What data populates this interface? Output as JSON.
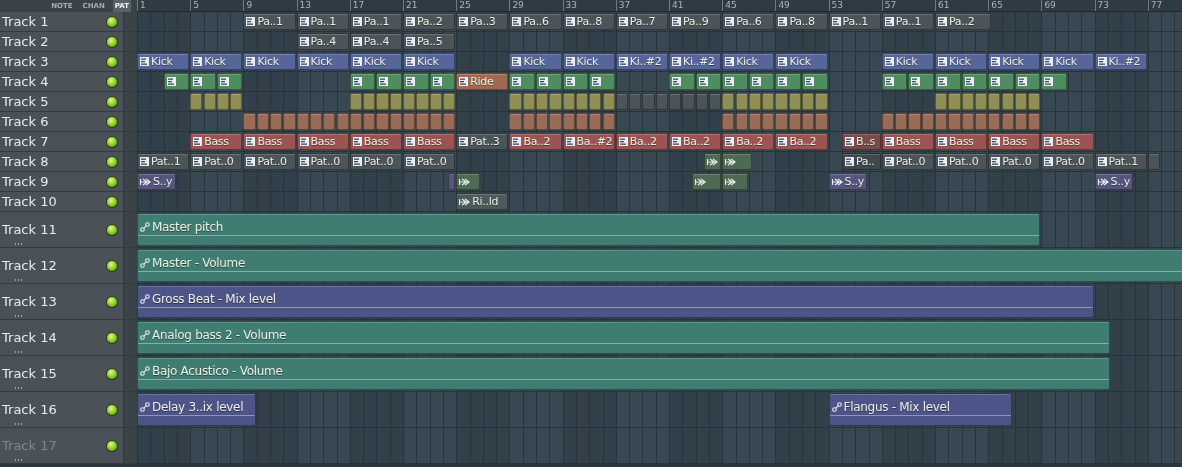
{
  "view_tabs": [
    {
      "label": "NOTE",
      "selected": false
    },
    {
      "label": "CHAN",
      "selected": false
    },
    {
      "label": "PAT",
      "selected": true
    }
  ],
  "ruler": [
    "1",
    "5",
    "9",
    "13",
    "17",
    "21",
    "25",
    "29",
    "33",
    "37",
    "41",
    "45",
    "49",
    "53",
    "57",
    "61",
    "65",
    "69",
    "73",
    "77"
  ],
  "tracks": [
    {
      "name": "Track 1",
      "tall": false,
      "disabled": false,
      "clips": [
        {
          "kind": "pattern",
          "label": "Pa..1",
          "color": "#4a5459"
        },
        {
          "kind": "pattern",
          "label": "Pa..1",
          "color": "#4a5459"
        },
        {
          "kind": "pattern",
          "label": "Pa..1",
          "color": "#4a5459"
        },
        {
          "kind": "pattern",
          "label": "Pa..2",
          "color": "#4a5459"
        },
        {
          "kind": "pattern",
          "label": "Pa..3",
          "color": "#4a5459"
        },
        {
          "kind": "pattern",
          "label": "Pa..6",
          "color": "#4a5459"
        },
        {
          "kind": "pattern",
          "label": "Pa..8",
          "color": "#4a5459"
        },
        {
          "kind": "pattern",
          "label": "Pa..7",
          "color": "#4a5459"
        },
        {
          "kind": "pattern",
          "label": "Pa..9",
          "color": "#4a5459"
        },
        {
          "kind": "pattern",
          "label": "Pa..6",
          "color": "#4a5459"
        },
        {
          "kind": "pattern",
          "label": "Pa..8",
          "color": "#4a5459"
        },
        {
          "kind": "pattern",
          "label": "Pa..1",
          "color": "#4a5459"
        },
        {
          "kind": "pattern",
          "label": "Pa..1",
          "color": "#4a5459"
        },
        {
          "kind": "pattern",
          "label": "Pa..2",
          "color": "#4a5459"
        }
      ]
    },
    {
      "name": "Track 2",
      "tall": false,
      "disabled": false,
      "clips": [
        {
          "kind": "pattern",
          "label": "Pa..4",
          "color": "#4a5459"
        },
        {
          "kind": "pattern",
          "label": "Pa..4",
          "color": "#4a5459"
        },
        {
          "kind": "pattern",
          "label": "Pa..5",
          "color": "#4a5459"
        }
      ]
    },
    {
      "name": "Track 3",
      "tall": false,
      "disabled": false,
      "clips": [
        {
          "kind": "pattern",
          "label": "Kick",
          "color": "#56669a"
        },
        {
          "kind": "pattern",
          "label": "Kick",
          "color": "#56669a"
        },
        {
          "kind": "pattern",
          "label": "Kick",
          "color": "#56669a"
        },
        {
          "kind": "pattern",
          "label": "Kick",
          "color": "#56669a"
        },
        {
          "kind": "pattern",
          "label": "Kick",
          "color": "#56669a"
        },
        {
          "kind": "pattern",
          "label": "Kick",
          "color": "#56669a"
        },
        {
          "kind": "pattern",
          "label": "Kick",
          "color": "#56669a"
        },
        {
          "kind": "pattern",
          "label": "Kick",
          "color": "#56669a"
        },
        {
          "kind": "pattern",
          "label": "Ki..#2",
          "color": "#56669a"
        },
        {
          "kind": "pattern",
          "label": "Ki..#2",
          "color": "#56669a"
        },
        {
          "kind": "pattern",
          "label": "Kick",
          "color": "#56669a"
        },
        {
          "kind": "pattern",
          "label": "Kick",
          "color": "#56669a"
        },
        {
          "kind": "pattern",
          "label": "Kick",
          "color": "#56669a"
        },
        {
          "kind": "pattern",
          "label": "Kick",
          "color": "#56669a"
        },
        {
          "kind": "pattern",
          "label": "Kick",
          "color": "#56669a"
        },
        {
          "kind": "pattern",
          "label": "Kick",
          "color": "#56669a"
        },
        {
          "kind": "pattern",
          "label": "Ki..#2",
          "color": "#56669a"
        }
      ]
    },
    {
      "name": "Track 4",
      "tall": false,
      "disabled": false,
      "clips": [
        {
          "kind": "pattern",
          "color": "#4f8d60"
        },
        {
          "kind": "pattern",
          "color": "#4f8d60"
        },
        {
          "kind": "pattern",
          "label": "Ride",
          "color": "#a06a52"
        },
        {
          "kind": "pattern",
          "color": "#4f8d60"
        },
        {
          "kind": "pattern",
          "color": "#4f8d60"
        },
        {
          "kind": "pattern",
          "color": "#4f8d60"
        }
      ]
    },
    {
      "name": "Track 5",
      "tall": false,
      "disabled": false,
      "clips": [
        {
          "kind": "pattern",
          "color": "#8e8e55"
        },
        {
          "kind": "pattern",
          "color": "#8e8e55"
        },
        {
          "kind": "pattern",
          "color": "#8e8e55"
        },
        {
          "kind": "pattern",
          "color": "#4a5459"
        },
        {
          "kind": "pattern",
          "color": "#8e8e55"
        },
        {
          "kind": "pattern",
          "color": "#8e8e55"
        }
      ]
    },
    {
      "name": "Track 6",
      "tall": false,
      "disabled": false,
      "clips": [
        {
          "kind": "pattern",
          "color": "#9a6c58"
        },
        {
          "kind": "pattern",
          "color": "#9a6c58"
        },
        {
          "kind": "pattern",
          "color": "#9a6c58"
        },
        {
          "kind": "pattern",
          "color": "#9a6c58"
        }
      ]
    },
    {
      "name": "Track 7",
      "tall": false,
      "disabled": false,
      "clips": [
        {
          "kind": "pattern",
          "label": "Bass",
          "color": "#9c5452"
        },
        {
          "kind": "pattern",
          "label": "Bass",
          "color": "#9c5452"
        },
        {
          "kind": "pattern",
          "label": "Bass",
          "color": "#9c5452"
        },
        {
          "kind": "pattern",
          "label": "Bass",
          "color": "#9c5452"
        },
        {
          "kind": "pattern",
          "label": "Bass",
          "color": "#9c5452"
        },
        {
          "kind": "pattern",
          "label": "Pat..3",
          "color": "#4a5459"
        },
        {
          "kind": "pattern",
          "label": "Ba..2",
          "color": "#9c5452"
        },
        {
          "kind": "pattern",
          "label": "Ba..#2",
          "color": "#9c5452"
        },
        {
          "kind": "pattern",
          "label": "Ba..2",
          "color": "#9c5452"
        },
        {
          "kind": "pattern",
          "label": "Ba..2",
          "color": "#9c5452"
        },
        {
          "kind": "pattern",
          "label": "Ba..2",
          "color": "#9c5452"
        },
        {
          "kind": "pattern",
          "label": "Ba..2",
          "color": "#9c5452"
        },
        {
          "kind": "pattern",
          "label": "B..s",
          "color": "#7a4a4a"
        },
        {
          "kind": "pattern",
          "label": "Bass",
          "color": "#9c5452"
        },
        {
          "kind": "pattern",
          "label": "Bass",
          "color": "#9c5452"
        },
        {
          "kind": "pattern",
          "label": "Bass",
          "color": "#9c5452"
        },
        {
          "kind": "pattern",
          "label": "Bass",
          "color": "#9c5452"
        }
      ]
    },
    {
      "name": "Track 8",
      "tall": false,
      "disabled": false,
      "clips": [
        {
          "kind": "pattern",
          "label": "Pat..1",
          "color": "#4a5459"
        },
        {
          "kind": "pattern",
          "label": "Pat..0",
          "color": "#4a5459"
        },
        {
          "kind": "pattern",
          "label": "Pat..0",
          "color": "#4a5459"
        },
        {
          "kind": "pattern",
          "label": "Pat..0",
          "color": "#4a5459"
        },
        {
          "kind": "pattern",
          "label": "Pat..0",
          "color": "#4a5459"
        },
        {
          "kind": "pattern",
          "label": "Pat..0",
          "color": "#4a5459"
        },
        {
          "kind": "audio",
          "color": "#4f6a52"
        },
        {
          "kind": "audio",
          "color": "#4f6a52"
        },
        {
          "kind": "pattern",
          "label": "Pa..",
          "color": "#3f484d"
        },
        {
          "kind": "pattern",
          "label": "Pat..0",
          "color": "#4a5459"
        },
        {
          "kind": "pattern",
          "label": "Pat..0",
          "color": "#4a5459"
        },
        {
          "kind": "pattern",
          "label": "Pat..0",
          "color": "#4a5459"
        },
        {
          "kind": "pattern",
          "label": "Pat..0",
          "color": "#4a5459"
        },
        {
          "kind": "pattern",
          "label": "Pat..1",
          "color": "#4a5459"
        },
        {
          "kind": "pattern",
          "color": "#4a5459"
        }
      ]
    },
    {
      "name": "Track 9",
      "tall": false,
      "disabled": false,
      "clips": [
        {
          "kind": "audio",
          "label": "S..y",
          "color": "#56567c"
        },
        {
          "kind": "audio",
          "color": "#56567c"
        },
        {
          "kind": "audio",
          "color": "#4f6a52"
        },
        {
          "kind": "audio",
          "color": "#4f6a52"
        },
        {
          "kind": "audio",
          "color": "#4f6a52"
        },
        {
          "kind": "audio",
          "label": "S..y",
          "color": "#56567c"
        },
        {
          "kind": "audio",
          "label": "S..y",
          "color": "#56567c"
        }
      ]
    },
    {
      "name": "Track 10",
      "tall": false,
      "disabled": false,
      "clips": [
        {
          "kind": "audio",
          "label": "Ri..ld",
          "color": "#4c5a5a"
        }
      ]
    },
    {
      "name": "Track 11",
      "tall": true,
      "disabled": false,
      "clips": [
        {
          "kind": "automation",
          "label": "Master pitch",
          "color": "#3f7c72"
        }
      ]
    },
    {
      "name": "Track 12",
      "tall": true,
      "disabled": false,
      "clips": [
        {
          "kind": "automation",
          "label": "Master - Volume",
          "color": "#3f7c72"
        }
      ]
    },
    {
      "name": "Track 13",
      "tall": true,
      "disabled": false,
      "clips": [
        {
          "kind": "automation",
          "label": "Gross Beat - Mix level",
          "color": "#4c5488"
        }
      ]
    },
    {
      "name": "Track 14",
      "tall": true,
      "disabled": false,
      "clips": [
        {
          "kind": "automation",
          "label": "Analog bass 2 - Volume",
          "color": "#3f7c72"
        }
      ]
    },
    {
      "name": "Track 15",
      "tall": true,
      "disabled": false,
      "clips": [
        {
          "kind": "automation",
          "label": "Bajo Acustico - Volume",
          "color": "#3f7c72"
        }
      ]
    },
    {
      "name": "Track 16",
      "tall": true,
      "disabled": false,
      "clips": [
        {
          "kind": "automation",
          "label": "Delay 3..ix level",
          "color": "#4c5488"
        },
        {
          "kind": "automation",
          "label": "Flangus - Mix level",
          "color": "#4c5488"
        }
      ]
    },
    {
      "name": "Track 17",
      "tall": true,
      "disabled": true
    }
  ]
}
